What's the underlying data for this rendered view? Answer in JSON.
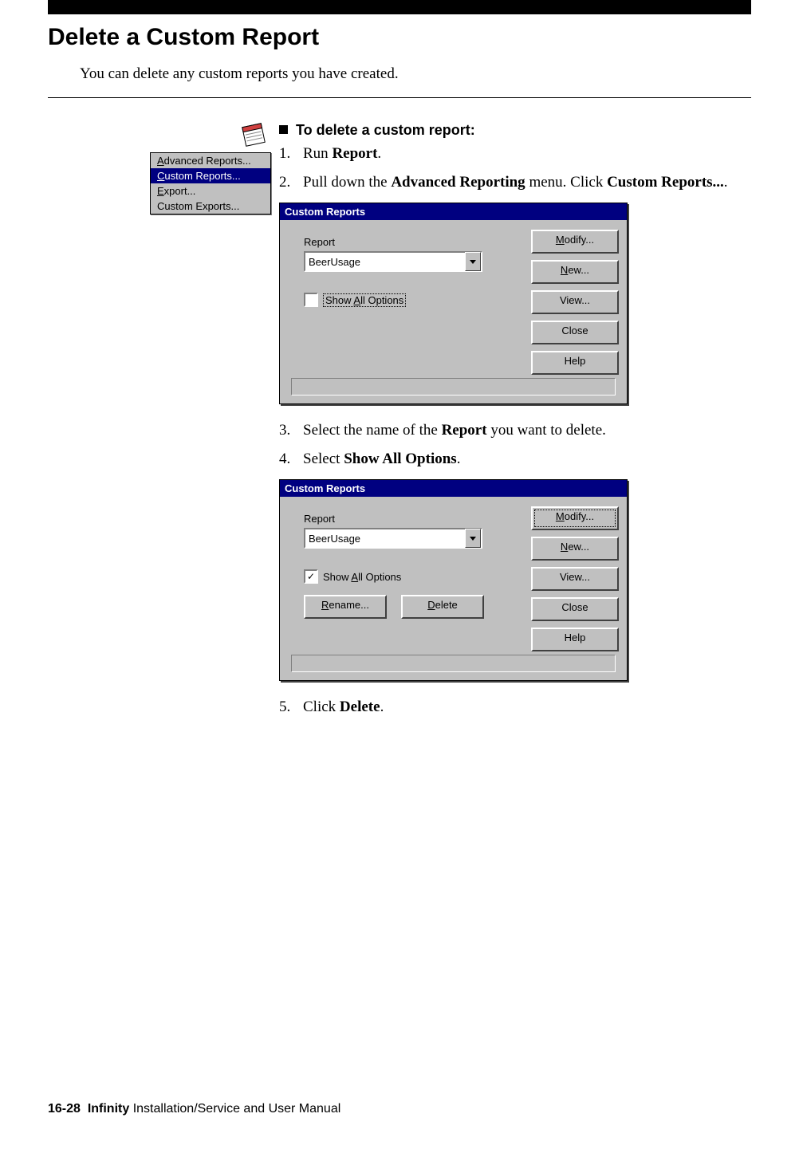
{
  "heading": "Delete a Custom Report",
  "intro": "You can delete any custom reports you have created.",
  "procedure_title": "To delete a custom report:",
  "steps": {
    "s1": {
      "num": "1.",
      "pre": "Run ",
      "bold": "Report",
      "post": "."
    },
    "s2": {
      "num": "2.",
      "pre": "Pull down the ",
      "bold1": "Advanced Reporting",
      "mid": " menu. Click ",
      "bold2": "Custom Reports...",
      "post": "."
    },
    "s3": {
      "num": "3.",
      "pre": "Select the name of the ",
      "bold": "Report",
      "post": " you want to delete."
    },
    "s4": {
      "num": "4.",
      "pre": "Select ",
      "bold": "Show All Options",
      "post": "."
    },
    "s5": {
      "num": "5.",
      "pre": "Click ",
      "bold": "Delete",
      "post": "."
    }
  },
  "menu": {
    "item1": "Advanced Reports...",
    "item2": "Custom Reports...",
    "item3": "Export...",
    "item4": "Custom Exports..."
  },
  "dialog": {
    "title": "Custom Reports",
    "report_label": "Report",
    "report_value": "BeerUsage",
    "show_all": "Show All Options",
    "show_all_u": "A",
    "btn_modify": "Modify...",
    "btn_modify_u": "M",
    "btn_new": "New...",
    "btn_new_u": "N",
    "btn_view": "View...",
    "btn_close": "Close",
    "btn_help": "Help",
    "btn_rename": "Rename...",
    "btn_rename_u": "R",
    "btn_delete": "Delete",
    "btn_delete_u": "D"
  },
  "footer": {
    "page": "16-28",
    "product": "Infinity",
    "rest": " Installation/Service and User Manual"
  }
}
